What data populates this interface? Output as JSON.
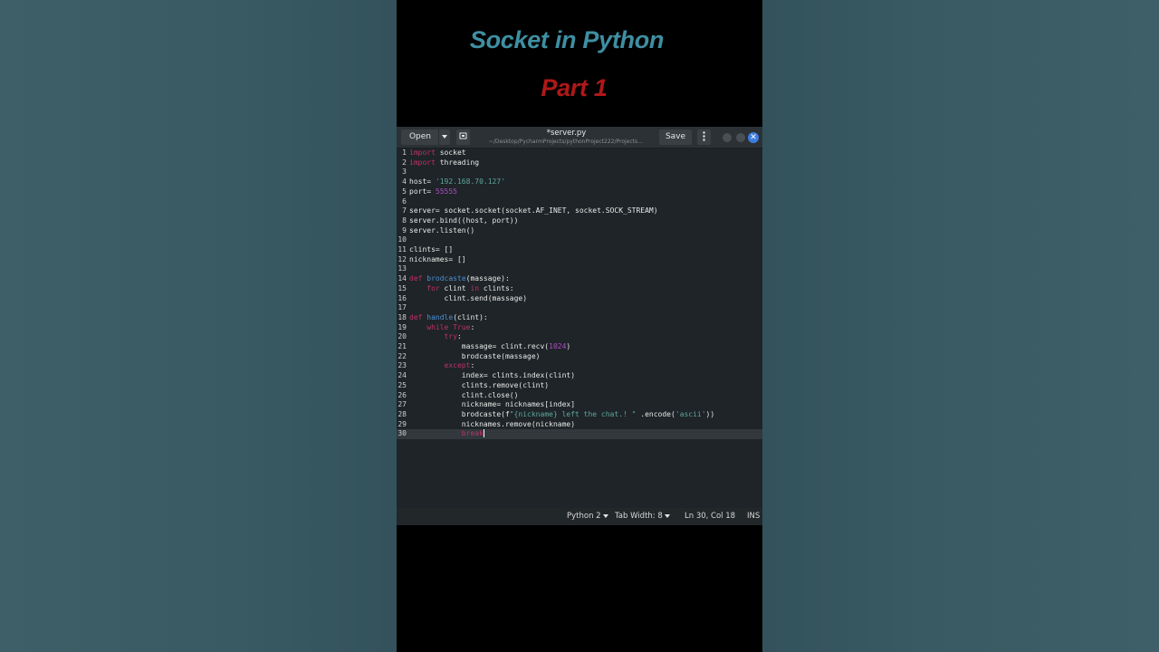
{
  "overlay": {
    "title": "Socket in Python",
    "subtitle": "Part 1"
  },
  "editor": {
    "header": {
      "open_label": "Open",
      "file_title": "*server.py",
      "file_path": "~/Desktop/PycharmProjects/pythonProject222/Projects…",
      "save_label": "Save"
    },
    "code_lines": [
      [
        [
          "k",
          "import"
        ],
        [
          "p",
          " socket"
        ]
      ],
      [
        [
          "k",
          "import"
        ],
        [
          "p",
          " threading"
        ]
      ],
      [],
      [
        [
          "p",
          "host= "
        ],
        [
          "s",
          "'192.168.70.127'"
        ]
      ],
      [
        [
          "p",
          "port= "
        ],
        [
          "n",
          "55555"
        ]
      ],
      [],
      [
        [
          "p",
          "server= socket.socket(socket.AF_INET, socket.SOCK_STREAM)"
        ]
      ],
      [
        [
          "p",
          "server.bind((host, port))"
        ]
      ],
      [
        [
          "p",
          "server.listen()"
        ]
      ],
      [],
      [
        [
          "p",
          "clints= []"
        ]
      ],
      [
        [
          "p",
          "nicknames= []"
        ]
      ],
      [],
      [
        [
          "k",
          "def"
        ],
        [
          "p",
          " "
        ],
        [
          "f",
          "brodcaste"
        ],
        [
          "p",
          "(massage):"
        ]
      ],
      [
        [
          "p",
          "    "
        ],
        [
          "k",
          "for"
        ],
        [
          "p",
          " clint "
        ],
        [
          "k",
          "in"
        ],
        [
          "p",
          " clints:"
        ]
      ],
      [
        [
          "p",
          "        clint.send(massage)"
        ]
      ],
      [],
      [
        [
          "k",
          "def"
        ],
        [
          "p",
          " "
        ],
        [
          "f",
          "handle"
        ],
        [
          "p",
          "(clint):"
        ]
      ],
      [
        [
          "p",
          "    "
        ],
        [
          "k",
          "while"
        ],
        [
          "p",
          " "
        ],
        [
          "k",
          "True"
        ],
        [
          "p",
          ":"
        ]
      ],
      [
        [
          "p",
          "        "
        ],
        [
          "k",
          "try"
        ],
        [
          "p",
          ":"
        ]
      ],
      [
        [
          "p",
          "            massage= clint.recv("
        ],
        [
          "n",
          "1024"
        ],
        [
          "p",
          ")"
        ]
      ],
      [
        [
          "p",
          "            brodcaste(massage)"
        ]
      ],
      [
        [
          "p",
          "        "
        ],
        [
          "k",
          "except"
        ],
        [
          "p",
          ":"
        ]
      ],
      [
        [
          "p",
          "            index= clints.index(clint)"
        ]
      ],
      [
        [
          "p",
          "            clints.remove(clint)"
        ]
      ],
      [
        [
          "p",
          "            clint.close()"
        ]
      ],
      [
        [
          "p",
          "            nickname= nicknames[index]"
        ]
      ],
      [
        [
          "p",
          "            brodcaste(f"
        ],
        [
          "s",
          "\"{nickname} left the chat.! \""
        ],
        [
          "p",
          " .encode("
        ],
        [
          "s",
          "'ascii'"
        ],
        [
          "p",
          "))"
        ]
      ],
      [
        [
          "p",
          "            nicknames.remove(nickname)"
        ]
      ],
      [
        [
          "p",
          "            "
        ],
        [
          "k",
          "break"
        ]
      ]
    ],
    "current_line": 30,
    "status": {
      "language": "Python 2",
      "tab_width": "Tab Width: 8",
      "position": "Ln 30, Col 18",
      "mode": "INS"
    },
    "colors": {
      "keyword": "#c0306a",
      "string": "#5ea89d",
      "number": "#b04cc8",
      "function": "#4a8fd8",
      "title": "#3f8fa2",
      "subtitle": "#b01818"
    }
  }
}
